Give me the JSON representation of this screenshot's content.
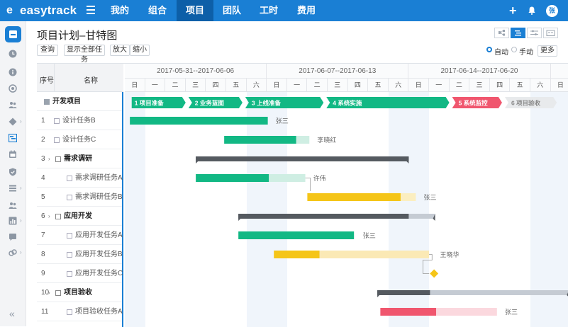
{
  "app": {
    "brand": "easytrack",
    "logo_mark": "e",
    "avatar_text": "张"
  },
  "nav": [
    {
      "label": "我的"
    },
    {
      "label": "组合"
    },
    {
      "label": "项目"
    },
    {
      "label": "团队"
    },
    {
      "label": "工时"
    },
    {
      "label": "费用"
    }
  ],
  "page": {
    "title": "项目计划–甘特图"
  },
  "toolbar": {
    "query": "查询",
    "show_all": "显示全部任务",
    "zoom_in": "放大",
    "zoom_out": "缩小",
    "more": "更多"
  },
  "schedule_mode": {
    "auto": "自动",
    "manual": "手动",
    "selected": "auto"
  },
  "grid": {
    "col_index": "序号",
    "col_name": "名称"
  },
  "weeks": [
    "2017-05-31--2017-06-06",
    "2017-06-07--2017-06-13",
    "2017-06-14--2017-06-20"
  ],
  "days": [
    "日",
    "一",
    "二",
    "三",
    "四",
    "五",
    "六",
    "日",
    "一",
    "二",
    "三",
    "四",
    "五",
    "六",
    "日",
    "一",
    "二",
    "三",
    "四",
    "五",
    "六",
    "日"
  ],
  "phases": [
    "1 项目准备",
    "2 业务蓝图",
    "3 上线准备",
    "4 系统实施",
    "5 系统监控",
    "6 项目验收"
  ],
  "rows": [
    {
      "index": "",
      "name": "开发项目"
    },
    {
      "index": "1",
      "name": "设计任务B"
    },
    {
      "index": "2",
      "name": "设计任务C"
    },
    {
      "index": "3",
      "name": "需求调研"
    },
    {
      "index": "4",
      "name": "需求调研任务A"
    },
    {
      "index": "5",
      "name": "需求调研任务B"
    },
    {
      "index": "6",
      "name": "应用开发"
    },
    {
      "index": "7",
      "name": "应用开发任务A"
    },
    {
      "index": "8",
      "name": "应用开发任务B"
    },
    {
      "index": "9",
      "name": "应用开发任务C"
    },
    {
      "index": "10",
      "name": "项目验收"
    },
    {
      "index": "11",
      "name": "项目验收任务A"
    }
  ],
  "assignees": {
    "r1": "张三",
    "r2": "李晓红",
    "r4": "许伟",
    "r5": "张三",
    "r7": "张三",
    "r8": "王晓华",
    "r11": "张三"
  },
  "colors": {
    "brand": "#1a7fd4",
    "green": "#12b884",
    "yellow": "#f5c518",
    "red": "#f0566e",
    "summary": "#555a60"
  }
}
